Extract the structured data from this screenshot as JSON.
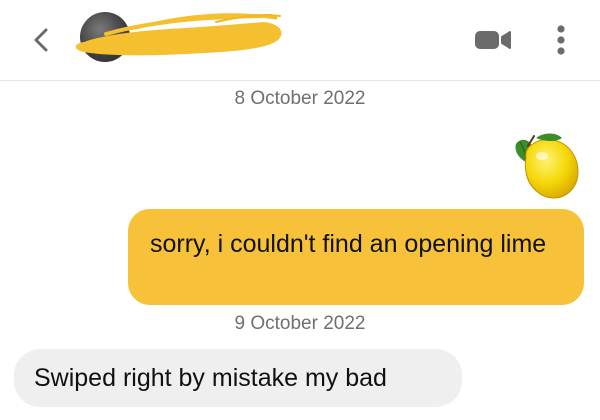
{
  "header": {
    "back_icon": "chevron-left-icon",
    "video_icon": "video-camera-icon",
    "more_icon": "more-vertical-icon",
    "redaction_color": "#f5c02f"
  },
  "messages": [
    {
      "type": "date",
      "text": "8 October 2022"
    },
    {
      "type": "emoji",
      "direction": "outgoing",
      "emoji": "lemon",
      "text": "🍋"
    },
    {
      "type": "text",
      "direction": "outgoing",
      "text": "sorry, i couldn't find an opening lime",
      "bubble_color": "#f7c23a"
    },
    {
      "type": "date",
      "text": "9 October 2022"
    },
    {
      "type": "text",
      "direction": "incoming",
      "text": "Swiped right by mistake my bad",
      "bubble_color": "#efefef"
    }
  ]
}
